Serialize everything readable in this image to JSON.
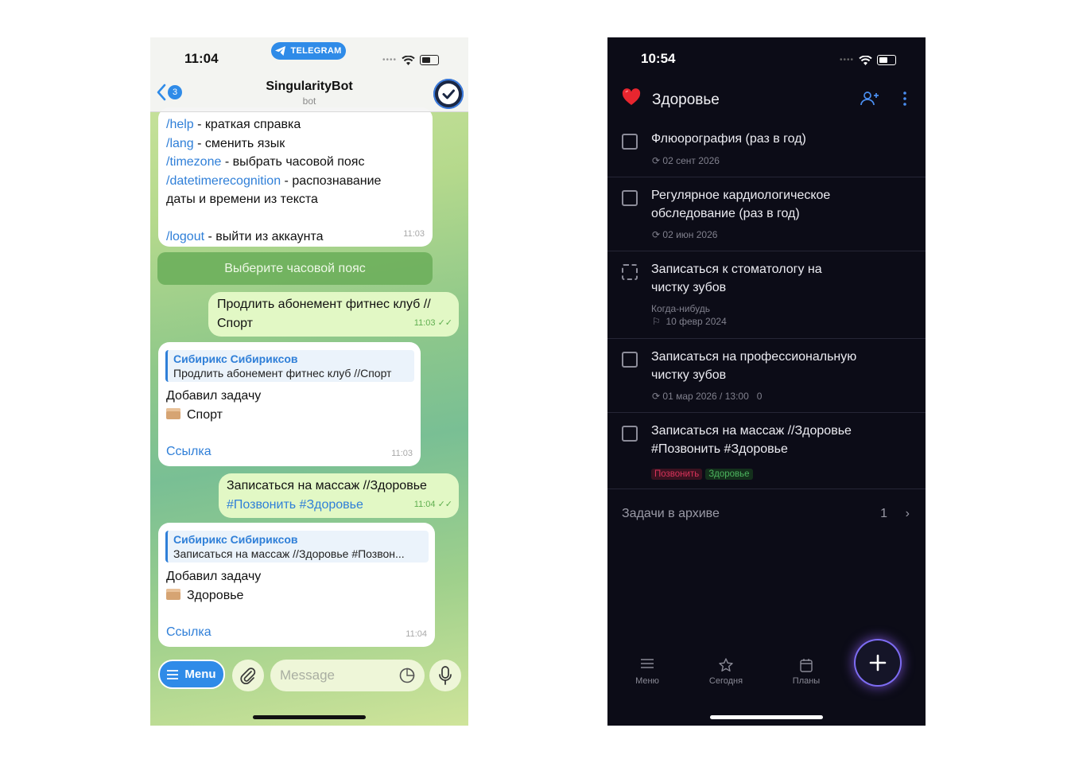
{
  "telegram": {
    "status": {
      "time": "11:04",
      "app_pill": "TELEGRAM"
    },
    "header": {
      "back_badge": "3",
      "title": "SingularityBot",
      "subtitle": "bot"
    },
    "help_message": {
      "lines": [
        {
          "cmd": "/help",
          "text": " - краткая справка"
        },
        {
          "cmd": "/lang",
          "text": " - сменить язык"
        },
        {
          "cmd": "/timezone",
          "text": " - выбрать часовой пояс"
        },
        {
          "cmd": "/datetimerecognition",
          "text": " - распознавание"
        }
      ],
      "continuation": "даты и времени из текста",
      "logout_cmd": "/logout",
      "logout_text": " - выйти из аккаунта",
      "time": "11:03"
    },
    "keyboard_button": "Выберите часовой пояс",
    "outgoing_1": {
      "line1": "Продлить абонемент фитнес клуб //",
      "line2": "Спорт",
      "time": "11:03"
    },
    "reply_1": {
      "reply_name": "Сибирикс Сибириксов",
      "reply_text": "Продлить абонемент фитнес клуб //Спорт",
      "line1": "Добавил задачу",
      "project": "Спорт",
      "link": "Ссылка",
      "time": "11:03"
    },
    "outgoing_2": {
      "line1": "Записаться на массаж //Здоровье",
      "line2": "#Позвонить #Здоровье",
      "time": "11:04"
    },
    "reply_2": {
      "reply_name": "Сибирикс Сибириксов",
      "reply_text": "Записаться на массаж //Здоровье #Позвон...",
      "line1": "Добавил задачу",
      "project": "Здоровье",
      "link": "Ссылка",
      "time": "11:04"
    },
    "bottom": {
      "menu_label": "Menu",
      "message_placeholder": "Message"
    }
  },
  "tasks_app": {
    "status": {
      "time": "10:54"
    },
    "project_title": "Здоровье",
    "tasks": [
      {
        "title_lines": [
          "Флюорография (раз в год)"
        ],
        "meta": "02 сент 2026"
      },
      {
        "title_lines": [
          "Регулярное кардиологическое",
          "обследование (раз в год)"
        ],
        "meta": "02 июн 2026"
      },
      {
        "title_lines": [
          "Записаться к стоматологу на",
          "чистку зубов"
        ],
        "meta_1": "Когда-нибудь",
        "meta_2": "10 февр 2024"
      },
      {
        "title_lines": [
          "Записаться на профессиональную",
          "чистку зубов"
        ],
        "meta": "01 мар 2026 / 13:00",
        "meta_extra": "0"
      },
      {
        "title_lines": [
          "Записаться на массаж //Здоровье",
          "#Позвонить #Здоровье"
        ],
        "tags": [
          "Позвонить",
          "Здоровье"
        ]
      }
    ],
    "archive": {
      "label": "Задачи в архиве",
      "count": "1"
    },
    "nav": [
      {
        "label": "Меню",
        "icon": "menu-icon"
      },
      {
        "label": "Сегодня",
        "icon": "star-icon"
      },
      {
        "label": "Планы",
        "icon": "calendar-icon"
      }
    ],
    "colors": {
      "background": "#0c0c17",
      "fab_glow": "#7d6cf2",
      "tag_red": "#d8335a",
      "tag_green": "#4cb35e"
    }
  }
}
